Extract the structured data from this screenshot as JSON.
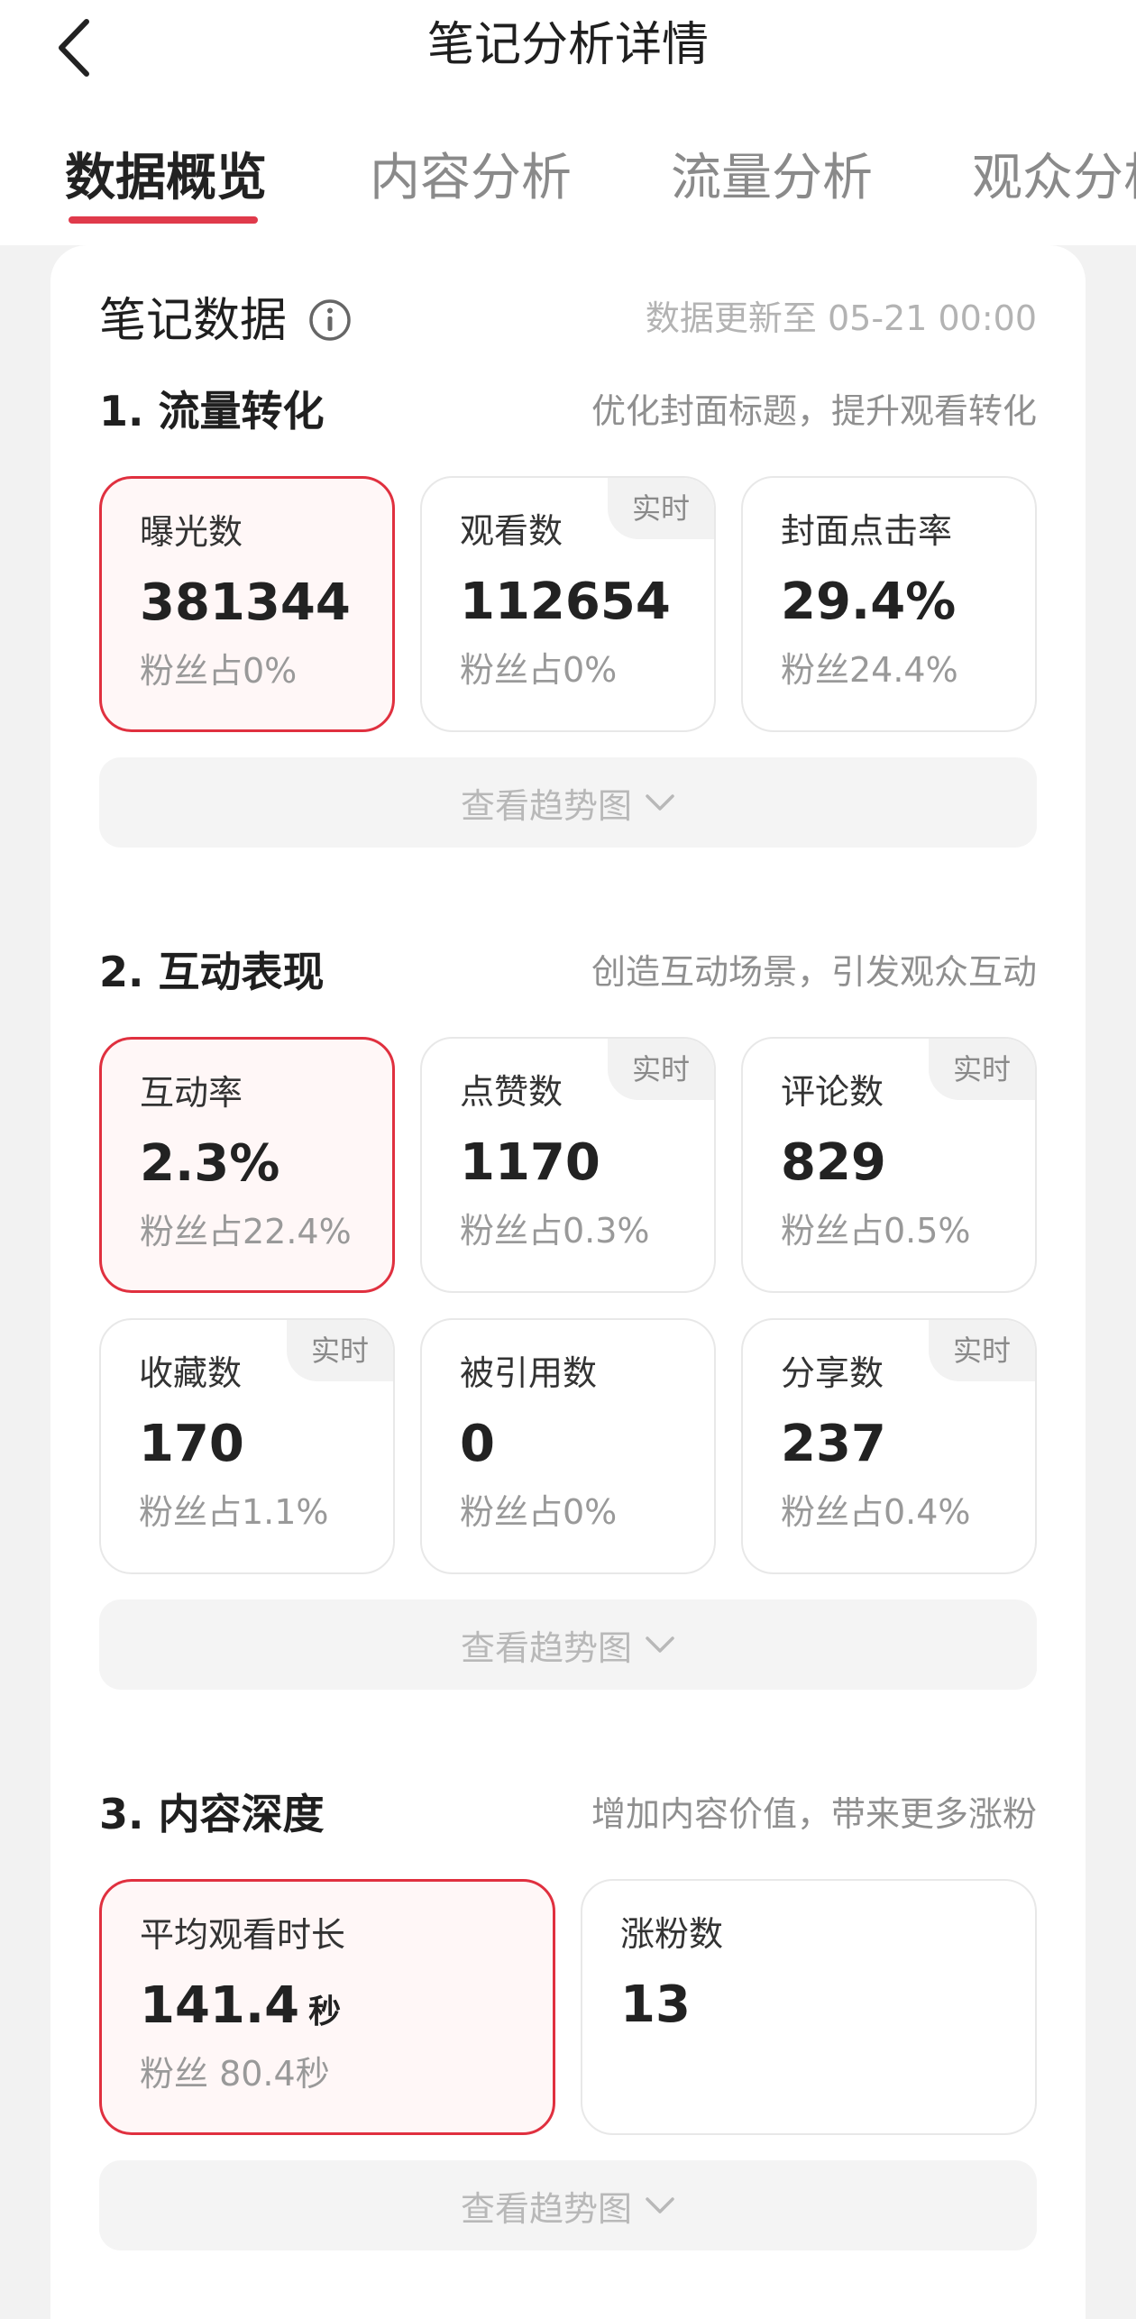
{
  "header": {
    "title": "笔记分析详情",
    "tabs": [
      {
        "label": "数据概览",
        "active": true
      },
      {
        "label": "内容分析",
        "active": false
      },
      {
        "label": "流量分析",
        "active": false
      },
      {
        "label": "观众分析",
        "active": false
      }
    ]
  },
  "card": {
    "title": "笔记数据",
    "update_text": "数据更新至 05-21 00:00",
    "trend_label": "查看趋势图",
    "realtime_badge": "实时"
  },
  "sections": [
    {
      "title": "1. 流量转化",
      "tip": "优化封面标题，提升观看转化",
      "metrics": [
        {
          "label": "曝光数",
          "value": "381344",
          "sub": "粉丝占0%",
          "realtime": false,
          "selected": true
        },
        {
          "label": "观看数",
          "value": "112654",
          "sub": "粉丝占0%",
          "realtime": true,
          "selected": false
        },
        {
          "label": "封面点击率",
          "value": "29.4%",
          "sub": "粉丝24.4%",
          "realtime": false,
          "selected": false
        }
      ]
    },
    {
      "title": "2. 互动表现",
      "tip": "创造互动场景，引发观众互动",
      "metrics": [
        {
          "label": "互动率",
          "value": "2.3%",
          "sub": "粉丝占22.4%",
          "realtime": false,
          "selected": true
        },
        {
          "label": "点赞数",
          "value": "1170",
          "sub": "粉丝占0.3%",
          "realtime": true,
          "selected": false
        },
        {
          "label": "评论数",
          "value": "829",
          "sub": "粉丝占0.5%",
          "realtime": true,
          "selected": false
        },
        {
          "label": "收藏数",
          "value": "170",
          "sub": "粉丝占1.1%",
          "realtime": true,
          "selected": false
        },
        {
          "label": "被引用数",
          "value": "0",
          "sub": "粉丝占0%",
          "realtime": false,
          "selected": false
        },
        {
          "label": "分享数",
          "value": "237",
          "sub": "粉丝占0.4%",
          "realtime": true,
          "selected": false
        }
      ]
    },
    {
      "title": "3. 内容深度",
      "tip": "增加内容价值，带来更多涨粉",
      "metrics": [
        {
          "label": "平均观看时长",
          "value": "141.4",
          "unit": "秒",
          "sub": "粉丝 80.4秒",
          "realtime": false,
          "selected": true
        },
        {
          "label": "涨粉数",
          "value": "13",
          "sub": "",
          "realtime": false,
          "selected": false
        }
      ]
    }
  ],
  "colors": {
    "accent": "#e03a4b",
    "selected_border": "#e0303f",
    "selected_bg": "#fff7f7",
    "page_bg": "#f2f2f2"
  },
  "icons": {
    "back": "chevron-left-icon",
    "info": "info-circle-icon",
    "expand": "chevron-down-icon"
  }
}
